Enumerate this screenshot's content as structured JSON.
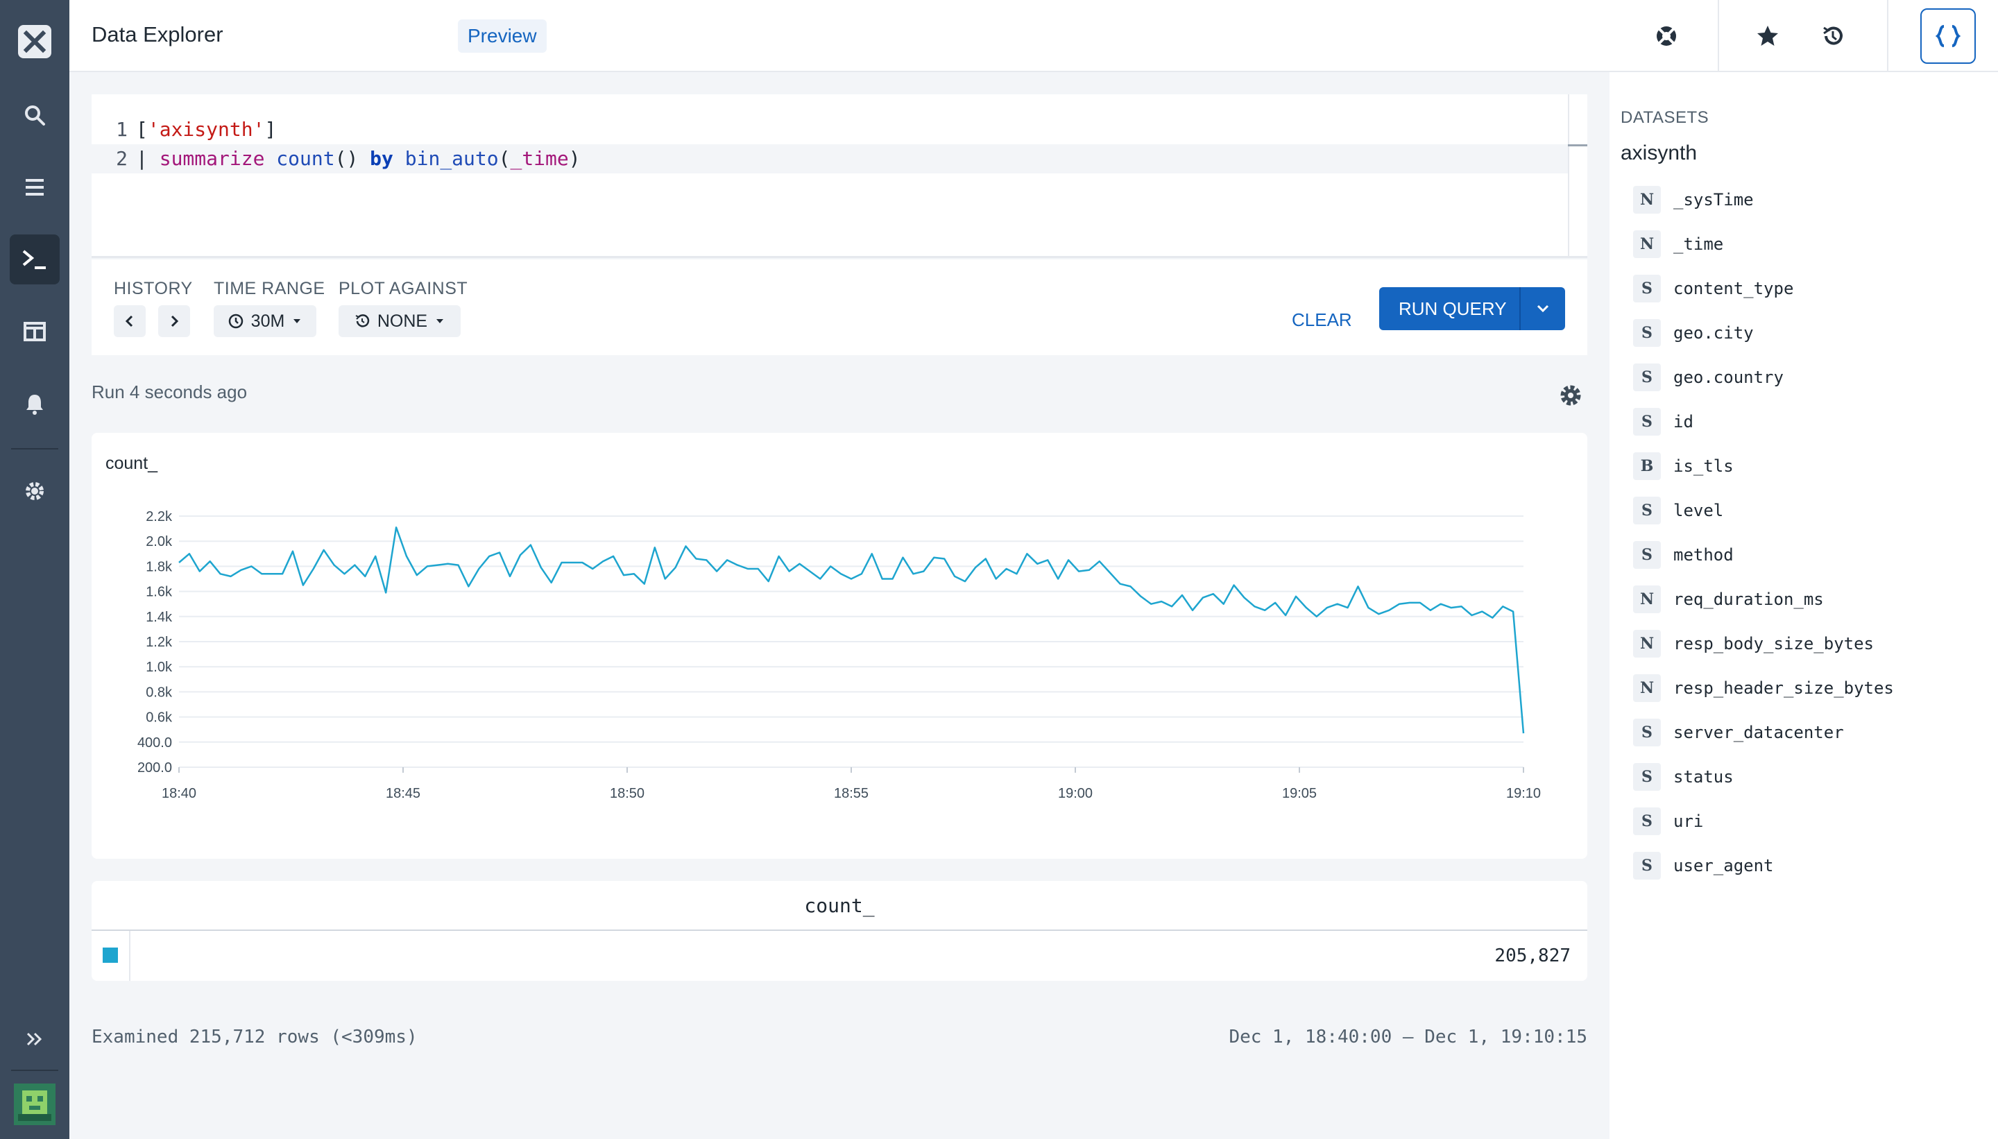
{
  "header": {
    "title": "Data Explorer",
    "badge": "Preview"
  },
  "editor": {
    "lines": [
      {
        "num": "1",
        "text": "['axisynth']"
      },
      {
        "num": "2",
        "text": "| summarize count() by bin_auto(_time)"
      }
    ]
  },
  "controls": {
    "history_label": "HISTORY",
    "time_range_label": "TIME RANGE",
    "time_range_value": "30M",
    "plot_against_label": "PLOT AGAINST",
    "plot_against_value": "NONE",
    "clear_label": "CLEAR",
    "run_label": "RUN QUERY"
  },
  "run_info": "Run 4 seconds ago",
  "chart_data": {
    "type": "line",
    "title": "count_",
    "x": [
      "18:40",
      "18:40:15",
      "18:40:30",
      "18:40:45",
      "18:41",
      "18:41:15",
      "18:41:30",
      "18:41:45",
      "18:42",
      "18:42:15",
      "18:42:30",
      "18:42:45",
      "18:43",
      "18:43:15",
      "18:43:30",
      "18:43:45",
      "18:44",
      "18:44:15",
      "18:44:30",
      "18:44:45",
      "18:45",
      "18:45:15",
      "18:45:30",
      "18:45:45",
      "18:46",
      "18:46:15",
      "18:46:30",
      "18:46:45",
      "18:47",
      "18:47:15",
      "18:47:30",
      "18:47:45",
      "18:48",
      "18:48:15",
      "18:48:30",
      "18:48:45",
      "18:49",
      "18:49:15",
      "18:49:30",
      "18:49:45",
      "18:50",
      "18:50:15",
      "18:50:30",
      "18:50:45",
      "18:51",
      "18:51:15",
      "18:51:30",
      "18:51:45",
      "18:52",
      "18:52:15",
      "18:52:30",
      "18:52:45",
      "18:53",
      "18:53:15",
      "18:53:30",
      "18:53:45",
      "18:54",
      "18:54:15",
      "18:54:30",
      "18:54:45",
      "18:55",
      "18:55:15",
      "18:55:30",
      "18:55:45",
      "18:56",
      "18:56:15",
      "18:56:30",
      "18:56:45",
      "18:57",
      "18:57:15",
      "18:57:30",
      "18:57:45",
      "18:58",
      "18:58:15",
      "18:58:30",
      "18:58:45",
      "18:59",
      "18:59:15",
      "18:59:30",
      "18:59:45",
      "19:00",
      "19:00:15",
      "19:00:30",
      "19:00:45",
      "19:01",
      "19:01:15",
      "19:01:30",
      "19:01:45",
      "19:02",
      "19:02:15",
      "19:02:30",
      "19:02:45",
      "19:03",
      "19:03:15",
      "19:03:30",
      "19:03:45",
      "19:04",
      "19:04:15",
      "19:04:30",
      "19:04:45",
      "19:05",
      "19:05:15",
      "19:05:30",
      "19:05:45",
      "19:06",
      "19:06:15",
      "19:06:30",
      "19:06:45",
      "19:07",
      "19:07:15",
      "19:07:30",
      "19:07:45",
      "19:08",
      "19:08:15",
      "19:08:30",
      "19:08:45",
      "19:09",
      "19:09:15",
      "19:09:30",
      "19:09:45",
      "19:10",
      "19:10:15"
    ],
    "values": [
      1830,
      1900,
      1760,
      1840,
      1740,
      1720,
      1770,
      1800,
      1740,
      1740,
      1740,
      1920,
      1650,
      1780,
      1930,
      1810,
      1740,
      1810,
      1720,
      1880,
      1590,
      2110,
      1880,
      1730,
      1800,
      1810,
      1820,
      1810,
      1640,
      1780,
      1880,
      1910,
      1720,
      1890,
      1970,
      1790,
      1670,
      1830,
      1830,
      1830,
      1780,
      1840,
      1880,
      1730,
      1740,
      1660,
      1950,
      1700,
      1790,
      1960,
      1860,
      1850,
      1760,
      1850,
      1810,
      1780,
      1780,
      1680,
      1880,
      1760,
      1820,
      1760,
      1700,
      1800,
      1740,
      1700,
      1740,
      1900,
      1700,
      1700,
      1870,
      1740,
      1760,
      1870,
      1860,
      1720,
      1680,
      1790,
      1860,
      1700,
      1780,
      1740,
      1900,
      1820,
      1850,
      1700,
      1850,
      1760,
      1770,
      1840,
      1750,
      1660,
      1640,
      1560,
      1500,
      1520,
      1480,
      1570,
      1450,
      1550,
      1580,
      1500,
      1650,
      1550,
      1480,
      1450,
      1510,
      1410,
      1560,
      1470,
      1400,
      1470,
      1500,
      1470,
      1640,
      1470,
      1420,
      1450,
      1500,
      1510,
      1510,
      1450,
      1500,
      1470,
      1480,
      1410,
      1440,
      1390,
      1480,
      1440,
      470
    ],
    "y_ticks": [
      "2.2k",
      "2.0k",
      "1.8k",
      "1.6k",
      "1.4k",
      "1.2k",
      "1.0k",
      "0.8k",
      "0.6k",
      "400.0",
      "200.0"
    ],
    "x_ticks": [
      "18:40",
      "18:45",
      "18:50",
      "18:55",
      "19:00",
      "19:05",
      "19:10"
    ],
    "ylim": [
      200,
      2200
    ],
    "grid": true,
    "color": "#1ea5cf"
  },
  "table": {
    "column": "count_",
    "value": "205,827",
    "swatch_color": "#1ea5cf"
  },
  "footer": {
    "left": "Examined 215,712 rows (<309ms)",
    "right": "Dec 1, 18:40:00 — Dec 1, 19:10:15"
  },
  "datasets": {
    "title": "DATASETS",
    "name": "axisynth",
    "fields": [
      {
        "type": "N",
        "name": "_sysTime"
      },
      {
        "type": "N",
        "name": "_time"
      },
      {
        "type": "S",
        "name": "content_type"
      },
      {
        "type": "S",
        "name": "geo.city"
      },
      {
        "type": "S",
        "name": "geo.country"
      },
      {
        "type": "S",
        "name": "id"
      },
      {
        "type": "B",
        "name": "is_tls"
      },
      {
        "type": "S",
        "name": "level"
      },
      {
        "type": "S",
        "name": "method"
      },
      {
        "type": "N",
        "name": "req_duration_ms"
      },
      {
        "type": "N",
        "name": "resp_body_size_bytes"
      },
      {
        "type": "N",
        "name": "resp_header_size_bytes"
      },
      {
        "type": "S",
        "name": "server_datacenter"
      },
      {
        "type": "S",
        "name": "status"
      },
      {
        "type": "S",
        "name": "uri"
      },
      {
        "type": "S",
        "name": "user_agent"
      }
    ]
  }
}
